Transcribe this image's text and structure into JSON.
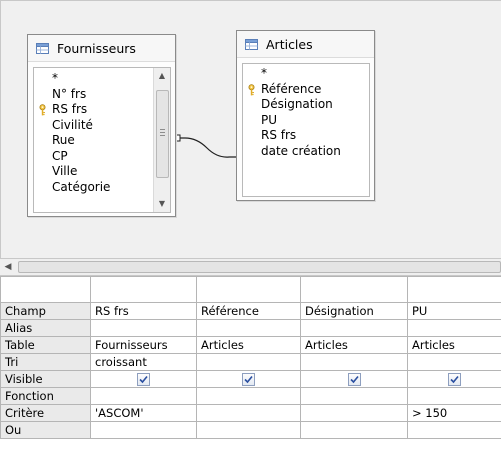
{
  "design": {
    "tables": [
      {
        "title": "Fournisseurs",
        "fields": [
          {
            "label": "*",
            "key": false
          },
          {
            "label": "N° frs",
            "key": false
          },
          {
            "label": "RS frs",
            "key": true
          },
          {
            "label": "Civilité",
            "key": false
          },
          {
            "label": "Rue",
            "key": false
          },
          {
            "label": "CP",
            "key": false
          },
          {
            "label": "Ville",
            "key": false
          },
          {
            "label": "Catégorie",
            "key": false
          }
        ]
      },
      {
        "title": "Articles",
        "fields": [
          {
            "label": "*",
            "key": false
          },
          {
            "label": "Référence",
            "key": true
          },
          {
            "label": "Désignation",
            "key": false
          },
          {
            "label": "PU",
            "key": false
          },
          {
            "label": "RS frs",
            "key": false
          },
          {
            "label": "date création",
            "key": false
          }
        ]
      }
    ]
  },
  "grid": {
    "row_headers": [
      "Champ",
      "Alias",
      "Table",
      "Tri",
      "Visible",
      "Fonction",
      "Critère",
      "Ou"
    ],
    "columns": [
      {
        "champ": "RS frs",
        "alias": "",
        "table": "Fournisseurs",
        "tri": "croissant",
        "visible": true,
        "fonction": "",
        "critere": "'ASCOM'",
        "ou": ""
      },
      {
        "champ": "Référence",
        "alias": "",
        "table": "Articles",
        "tri": "",
        "visible": true,
        "fonction": "",
        "critere": "",
        "ou": ""
      },
      {
        "champ": "Désignation",
        "alias": "",
        "table": "Articles",
        "tri": "",
        "visible": true,
        "fonction": "",
        "critere": "",
        "ou": ""
      },
      {
        "champ": "PU",
        "alias": "",
        "table": "Articles",
        "tri": "",
        "visible": true,
        "fonction": "",
        "critere": "> 150",
        "ou": ""
      }
    ]
  },
  "colors": {
    "pane_background": "#f0f0f0",
    "grid_border": "#b5b5b5",
    "row_header_background": "#eaeaea",
    "checkbox_tick": "#2a4fa0"
  },
  "icons": {
    "table": "table-icon",
    "primary_key": "key-icon",
    "scroll_left": "chevron-left-icon",
    "scroll_up": "chevron-up-icon",
    "scroll_down": "chevron-down-icon"
  }
}
